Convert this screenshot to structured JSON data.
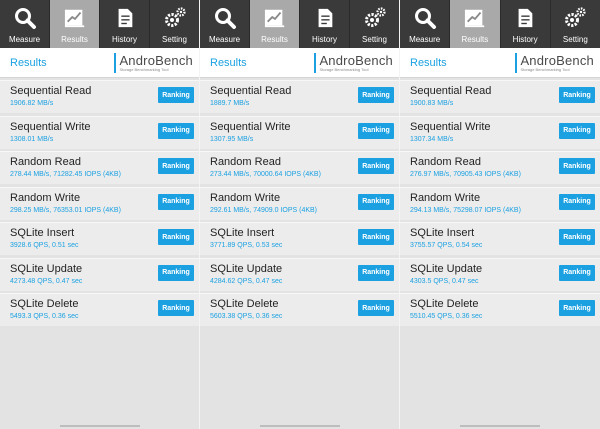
{
  "tabs": [
    {
      "label": "Measure",
      "icon": "magnifier-icon"
    },
    {
      "label": "Results",
      "icon": "chart-icon"
    },
    {
      "label": "History",
      "icon": "document-icon"
    },
    {
      "label": "Setting",
      "icon": "gear-icon"
    }
  ],
  "header": {
    "title": "Results",
    "logo_name": "AndroBench",
    "logo_sub": "Storage Benchmarking Tool"
  },
  "ranking_label": "Ranking",
  "accent_color": "#1ba1e2",
  "panels": [
    {
      "rows": [
        {
          "name": "Sequential Read",
          "value": "1906.82 MB/s"
        },
        {
          "name": "Sequential Write",
          "value": "1308.01 MB/s"
        },
        {
          "name": "Random Read",
          "value": "278.44 MB/s, 71282.45 IOPS (4KB)"
        },
        {
          "name": "Random Write",
          "value": "298.25 MB/s, 76353.01 IOPS (4KB)"
        },
        {
          "name": "SQLite Insert",
          "value": "3928.6 QPS, 0.51 sec"
        },
        {
          "name": "SQLite Update",
          "value": "4273.48 QPS, 0.47 sec"
        },
        {
          "name": "SQLite Delete",
          "value": "5493.3 QPS, 0.36 sec"
        }
      ]
    },
    {
      "rows": [
        {
          "name": "Sequential Read",
          "value": "1889.7 MB/s"
        },
        {
          "name": "Sequential Write",
          "value": "1307.95 MB/s"
        },
        {
          "name": "Random Read",
          "value": "273.44 MB/s, 70000.64 IOPS (4KB)"
        },
        {
          "name": "Random Write",
          "value": "292.61 MB/s, 74909.0 IOPS (4KB)"
        },
        {
          "name": "SQLite Insert",
          "value": "3771.89 QPS, 0.53 sec"
        },
        {
          "name": "SQLite Update",
          "value": "4284.62 QPS, 0.47 sec"
        },
        {
          "name": "SQLite Delete",
          "value": "5603.38 QPS, 0.36 sec"
        }
      ]
    },
    {
      "rows": [
        {
          "name": "Sequential Read",
          "value": "1900.83 MB/s"
        },
        {
          "name": "Sequential Write",
          "value": "1307.34 MB/s"
        },
        {
          "name": "Random Read",
          "value": "276.97 MB/s, 70905.43 IOPS (4KB)"
        },
        {
          "name": "Random Write",
          "value": "294.13 MB/s, 75298.07 IOPS (4KB)"
        },
        {
          "name": "SQLite Insert",
          "value": "3755.57 QPS, 0.54 sec"
        },
        {
          "name": "SQLite Update",
          "value": "4303.5 QPS, 0.47 sec"
        },
        {
          "name": "SQLite Delete",
          "value": "5510.45 QPS, 0.36 sec"
        }
      ]
    }
  ]
}
